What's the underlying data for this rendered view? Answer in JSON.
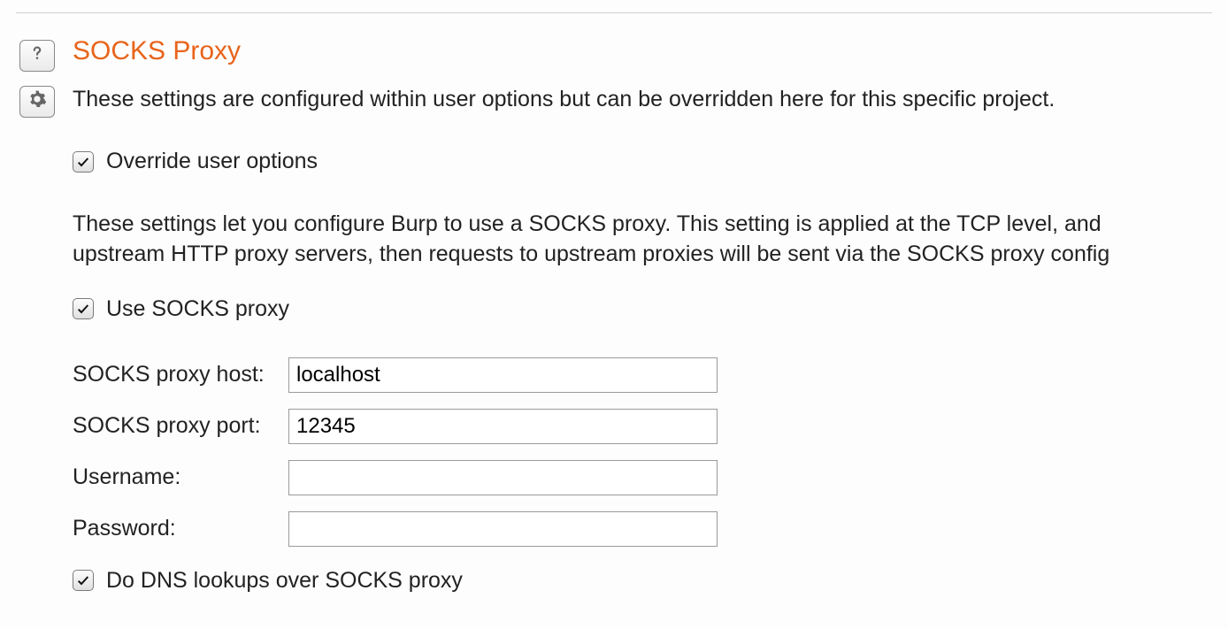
{
  "section": {
    "title": "SOCKS Proxy",
    "intro": "These settings are configured within user options but can be overridden here for this specific project.",
    "override_label": "Override user options",
    "desc_line1": "These settings let you configure Burp to use a SOCKS proxy. This setting is applied at the TCP level, and",
    "desc_line2": "upstream HTTP proxy servers, then requests to upstream proxies will be sent via the SOCKS proxy config",
    "use_proxy_label": "Use SOCKS proxy",
    "fields": {
      "host_label": "SOCKS proxy host:",
      "host_value": "localhost",
      "port_label": "SOCKS proxy port:",
      "port_value": "12345",
      "user_label": "Username:",
      "user_value": "",
      "pass_label": "Password:",
      "pass_value": ""
    },
    "dns_label": "Do DNS lookups over SOCKS proxy"
  },
  "checkboxes": {
    "override": true,
    "use_proxy": true,
    "dns": true
  }
}
